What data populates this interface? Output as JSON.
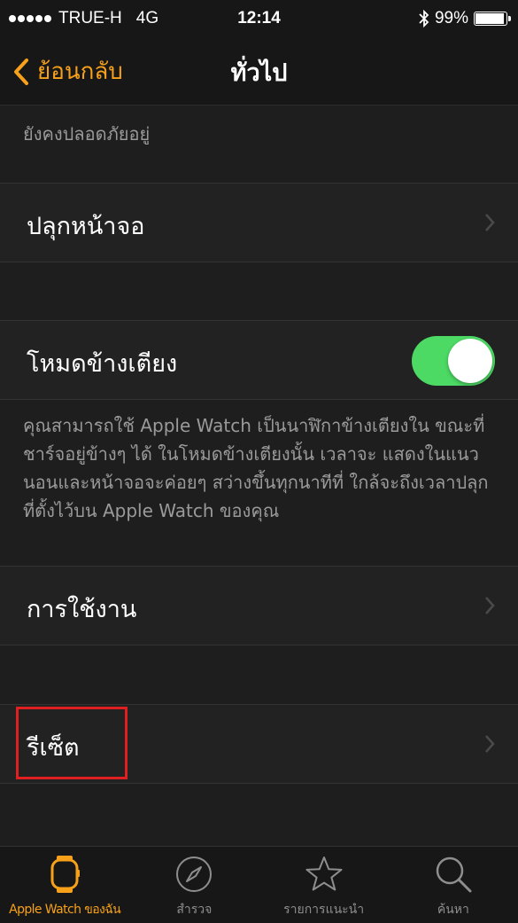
{
  "status_bar": {
    "carrier": "TRUE-H",
    "network": "4G",
    "time": "12:14",
    "battery": "99%",
    "battery_level": 0.99
  },
  "nav": {
    "back_label": "ย้อนกลับ",
    "title": "ทั่วไป"
  },
  "content": {
    "top_description": "ยังคงปลอดภัยอยู่",
    "rows": {
      "wake_screen": "ปลุกหน้าจอ",
      "nightstand": "โหมดข้างเตียง",
      "usage": "การใช้งาน",
      "reset": "รีเซ็ต"
    },
    "nightstand_on": true,
    "nightstand_description": "คุณสามารถใช้ Apple Watch เป็นนาฬิกาข้างเตียงใน ขณะที่ชาร์จอยู่ข้างๆ ได้ ในโหมดข้างเตียงนั้น เวลาจะ แสดงในแนวนอนและหน้าจอจะค่อยๆ สว่างขึ้นทุกนาทีที่ ใกล้จะถึงเวลาปลุกที่ตั้งไว้บน Apple Watch ของคุณ"
  },
  "tabs": [
    {
      "label": "Apple Watch ของฉัน",
      "icon": "watch-icon",
      "active": true
    },
    {
      "label": "สำรวจ",
      "icon": "compass-icon",
      "active": false
    },
    {
      "label": "รายการแนะนำ",
      "icon": "star-icon",
      "active": false
    },
    {
      "label": "ค้นหา",
      "icon": "search-icon",
      "active": false
    }
  ],
  "colors": {
    "accent": "#f7a11b",
    "toggle_on": "#4cd964",
    "highlight": "#e02020"
  }
}
